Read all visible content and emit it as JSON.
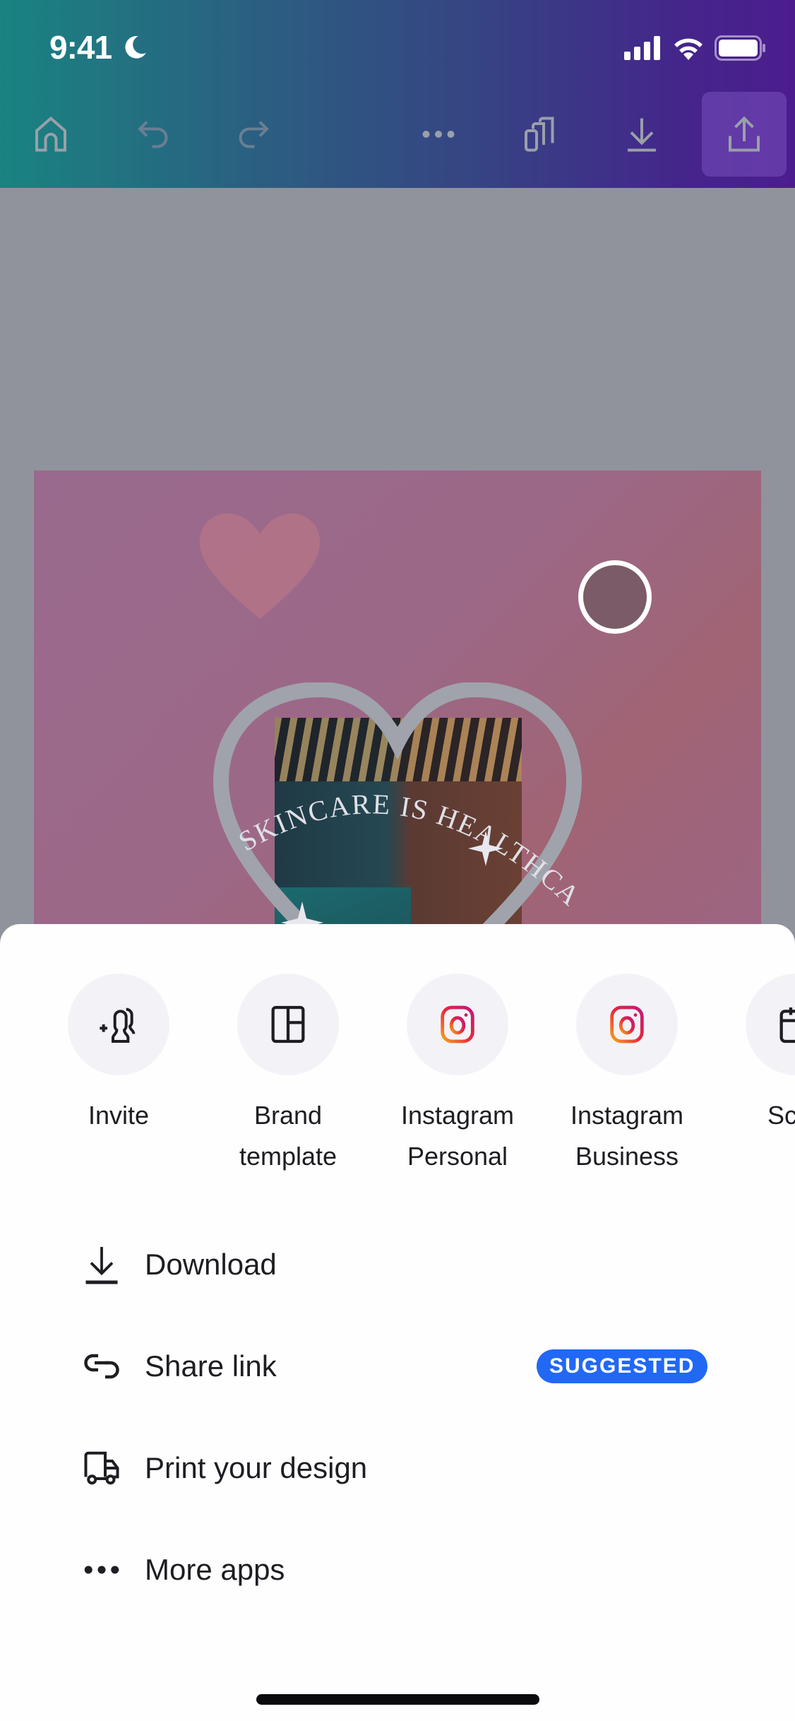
{
  "status_bar": {
    "time": "9:41",
    "icons": [
      "moon-icon",
      "signal-icon",
      "wifi-icon",
      "battery-icon"
    ]
  },
  "toolbar": {
    "buttons": [
      {
        "name": "home",
        "icon": "home-icon"
      },
      {
        "name": "undo",
        "icon": "undo-icon"
      },
      {
        "name": "redo",
        "icon": "redo-icon"
      },
      {
        "name": "more",
        "icon": "ellipsis-icon"
      },
      {
        "name": "pages",
        "icon": "pages-icon"
      },
      {
        "name": "download",
        "icon": "download-icon"
      },
      {
        "name": "share",
        "icon": "share-icon",
        "active": true
      }
    ]
  },
  "canvas": {
    "design_text": "SKINCARE IS HEALTHCARE",
    "colors": {
      "workspace": "#91939c",
      "design_bg": "#9a6a8e",
      "heart_frame": "#a0a3ab"
    }
  },
  "share_sheet": {
    "apps": [
      {
        "label": "Invite",
        "icon": "invite-people-icon"
      },
      {
        "label": "Brand\ntemplate",
        "icon": "brand-template-icon"
      },
      {
        "label": "Instagram\nPersonal",
        "icon": "instagram-icon"
      },
      {
        "label": "Instagram\nBusiness",
        "icon": "instagram-icon"
      },
      {
        "label": "Sche",
        "icon": "calendar-icon"
      }
    ],
    "list": [
      {
        "label": "Download",
        "icon": "download-icon"
      },
      {
        "label": "Share link",
        "icon": "link-icon",
        "badge": "SUGGESTED"
      },
      {
        "label": "Print your design",
        "icon": "truck-icon"
      },
      {
        "label": "More apps",
        "icon": "ellipsis-icon"
      }
    ],
    "colors": {
      "badge": "#2168f5",
      "app_circle": "#f3f3f7",
      "text": "#1d1d22"
    }
  }
}
